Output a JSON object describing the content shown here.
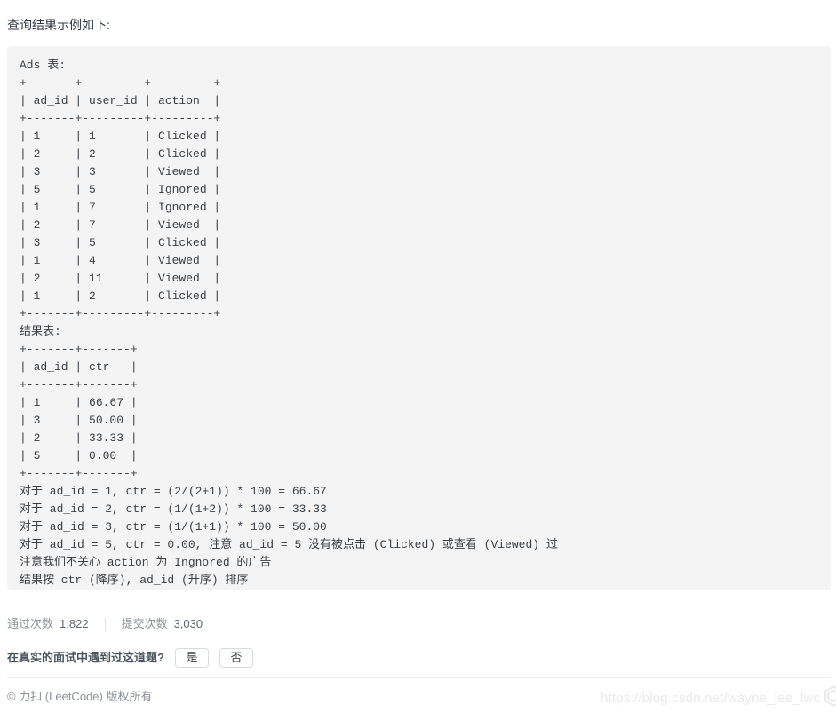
{
  "page": {
    "intro_text": "查询结果示例如下:",
    "background_color": "#ffffff",
    "code_block_background": "#f4f4f4",
    "text_color": "#3b4045"
  },
  "code_block": {
    "lines": [
      "Ads 表:",
      "+-------+---------+---------+",
      "| ad_id | user_id | action  |",
      "+-------+---------+---------+",
      "| 1     | 1       | Clicked |",
      "| 2     | 2       | Clicked |",
      "| 3     | 3       | Viewed  |",
      "| 5     | 5       | Ignored |",
      "| 1     | 7       | Ignored |",
      "| 2     | 7       | Viewed  |",
      "| 3     | 5       | Clicked |",
      "| 1     | 4       | Viewed  |",
      "| 2     | 11      | Viewed  |",
      "| 1     | 2       | Clicked |",
      "+-------+---------+---------+",
      "结果表:",
      "+-------+-------+",
      "| ad_id | ctr   |",
      "+-------+-------+",
      "| 1     | 66.67 |",
      "| 3     | 50.00 |",
      "| 2     | 33.33 |",
      "| 5     | 0.00  |",
      "+-------+-------+",
      "对于 ad_id = 1, ctr = (2/(2+1)) * 100 = 66.67",
      "对于 ad_id = 2, ctr = (1/(1+2)) * 100 = 33.33",
      "对于 ad_id = 3, ctr = (1/(1+1)) * 100 = 50.00",
      "对于 ad_id = 5, ctr = 0.00, 注意 ad_id = 5 没有被点击 (Clicked) 或查看 (Viewed) 过",
      "注意我们不关心 action 为 Ingnored 的广告",
      "结果按 ctr (降序), ad_id (升序) 排序"
    ],
    "tables": [
      {
        "name": "Ads 表",
        "columns": [
          "ad_id",
          "user_id",
          "action"
        ],
        "rows": [
          [
            "1",
            "1",
            "Clicked"
          ],
          [
            "2",
            "2",
            "Clicked"
          ],
          [
            "3",
            "3",
            "Viewed"
          ],
          [
            "5",
            "5",
            "Ignored"
          ],
          [
            "1",
            "7",
            "Ignored"
          ],
          [
            "2",
            "7",
            "Viewed"
          ],
          [
            "3",
            "5",
            "Clicked"
          ],
          [
            "1",
            "4",
            "Viewed"
          ],
          [
            "2",
            "11",
            "Viewed"
          ],
          [
            "1",
            "2",
            "Clicked"
          ]
        ]
      },
      {
        "name": "结果表",
        "columns": [
          "ad_id",
          "ctr"
        ],
        "rows": [
          [
            "1",
            "66.67"
          ],
          [
            "3",
            "50.00"
          ],
          [
            "2",
            "33.33"
          ],
          [
            "5",
            "0.00"
          ]
        ]
      }
    ],
    "explanations": [
      "对于 ad_id = 1, ctr = (2/(2+1)) * 100 = 66.67",
      "对于 ad_id = 2, ctr = (1/(1+2)) * 100 = 33.33",
      "对于 ad_id = 3, ctr = (1/(1+1)) * 100 = 50.00",
      "对于 ad_id = 5, ctr = 0.00, 注意 ad_id = 5 没有被点击 (Clicked) 或查看 (Viewed) 过",
      "注意我们不关心 action 为 Ingnored 的广告",
      "结果按 ctr (降序), ad_id (升序) 排序"
    ]
  },
  "stats": {
    "accepted_label": "通过次数",
    "accepted_value": "1,822",
    "submissions_label": "提交次数",
    "submissions_value": "3,030"
  },
  "interview": {
    "question": "在真实的面试中遇到过这道题?",
    "yes_label": "是",
    "no_label": "否"
  },
  "footer": {
    "copyright": "© 力扣 (LeetCode) 版权所有"
  },
  "watermark": {
    "url": "https://blog.csdn.net/wayne_lee_lwc",
    "logo_name": "csdn-logo",
    "color": "#e8e9ea"
  }
}
